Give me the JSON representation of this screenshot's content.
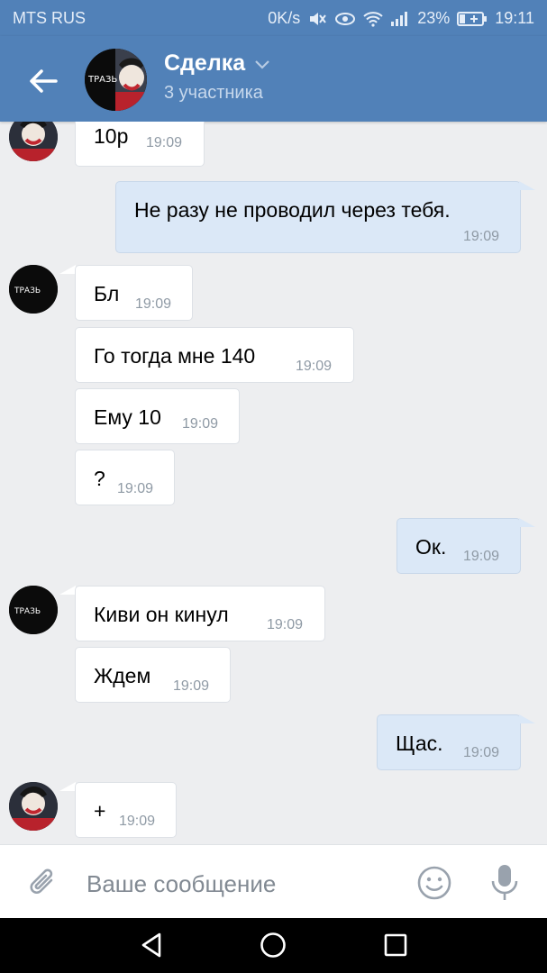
{
  "status_bar": {
    "carrier": "MTS RUS",
    "speed": "0K/s",
    "battery": "23%",
    "time": "19:11"
  },
  "header": {
    "title": "Сделка",
    "subtitle": "3 участника",
    "avatar_text": "ТРАЗЬ"
  },
  "messages": [
    {
      "text": "10р",
      "time": "19:09",
      "direction": "in"
    },
    {
      "text": "Не разу не проводил через тебя.",
      "time": "19:09",
      "direction": "out"
    },
    {
      "text": "Бл",
      "time": "19:09",
      "direction": "in"
    },
    {
      "text": "Го тогда мне 140",
      "time": "19:09",
      "direction": "in"
    },
    {
      "text": "Ему 10",
      "time": "19:09",
      "direction": "in"
    },
    {
      "text": "?",
      "time": "19:09",
      "direction": "in"
    },
    {
      "text": "Ок.",
      "time": "19:09",
      "direction": "out"
    },
    {
      "text": "Киви он кинул",
      "time": "19:09",
      "direction": "in"
    },
    {
      "text": "Ждем",
      "time": "19:09",
      "direction": "in"
    },
    {
      "text": "Щас.",
      "time": "19:09",
      "direction": "out"
    },
    {
      "text": "+",
      "time": "19:09",
      "direction": "in"
    }
  ],
  "avatar_label": "ТРАЗЬ",
  "composer": {
    "placeholder": "Ваше сообщение"
  },
  "icons": {
    "back": "arrow-left-icon",
    "dropdown": "chevron-down-icon",
    "attach": "paperclip-icon",
    "emoji": "smile-icon",
    "mic": "microphone-icon"
  },
  "colors": {
    "header": "#5181b8",
    "background": "#edeef0",
    "incoming_bubble": "#ffffff",
    "outgoing_bubble": "#dbe8f7"
  }
}
